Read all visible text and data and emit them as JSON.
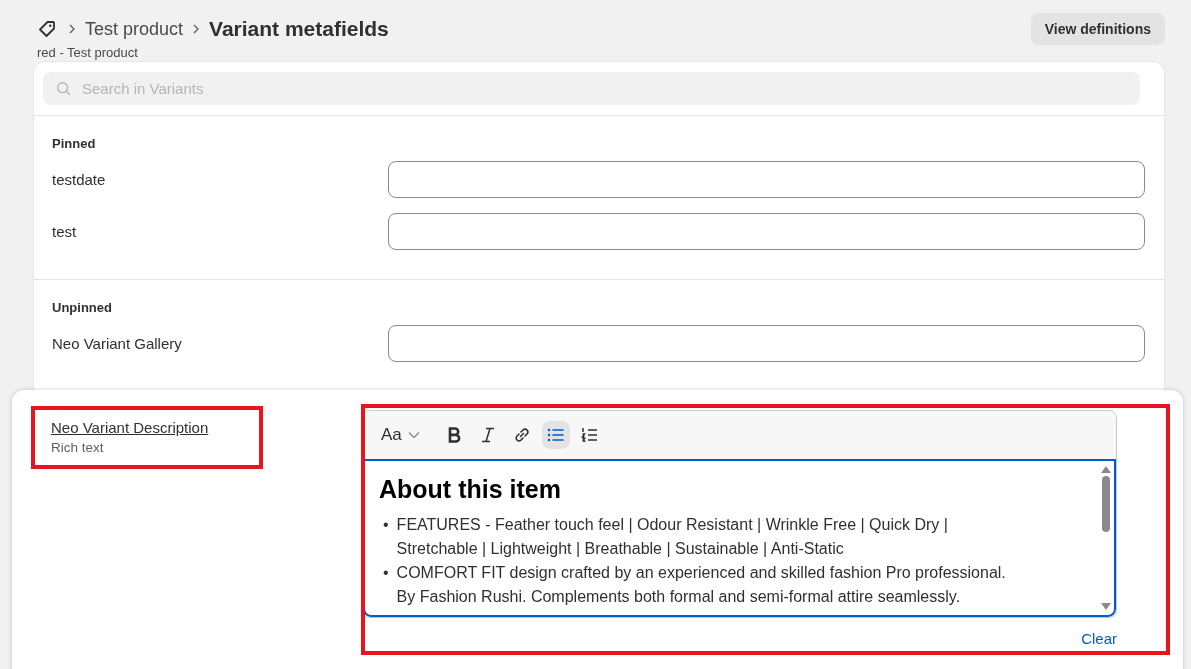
{
  "breadcrumb": {
    "parent": "Test product",
    "title": "Variant metafields",
    "subtitle": "red - Test product"
  },
  "header_button": "View definitions",
  "search": {
    "placeholder": "Search in Variants"
  },
  "sections": [
    {
      "title": "Pinned",
      "fields": [
        {
          "label": "testdate"
        },
        {
          "label": "test"
        }
      ]
    },
    {
      "title": "Unpinned",
      "fields": [
        {
          "label": "Neo Variant Gallery"
        }
      ]
    }
  ],
  "editor_panel": {
    "label": "Neo Variant Description",
    "type": "Rich text",
    "toolbar": [
      {
        "kind": "text-style",
        "label": "Aa",
        "selected": false
      },
      {
        "kind": "bold",
        "selected": false
      },
      {
        "kind": "italic",
        "selected": false
      },
      {
        "kind": "link",
        "selected": false
      },
      {
        "kind": "bullets",
        "selected": true
      },
      {
        "kind": "numbered",
        "selected": false
      }
    ],
    "heading": "About this item",
    "bullets": [
      {
        "marker": "•",
        "text": "FEATURES - Feather touch feel | Odour Resistant | Wrinkle Free | Quick Dry | Stretchable | Lightweight | Breathable | Sustainable | Anti-Static"
      },
      {
        "marker": "•",
        "text": "COMFORT FIT design crafted by an experienced and skilled fashion Pro professional. By Fashion Rushi. Complements both formal and semi-formal attire seamlessly."
      }
    ],
    "clear": "Clear"
  }
}
